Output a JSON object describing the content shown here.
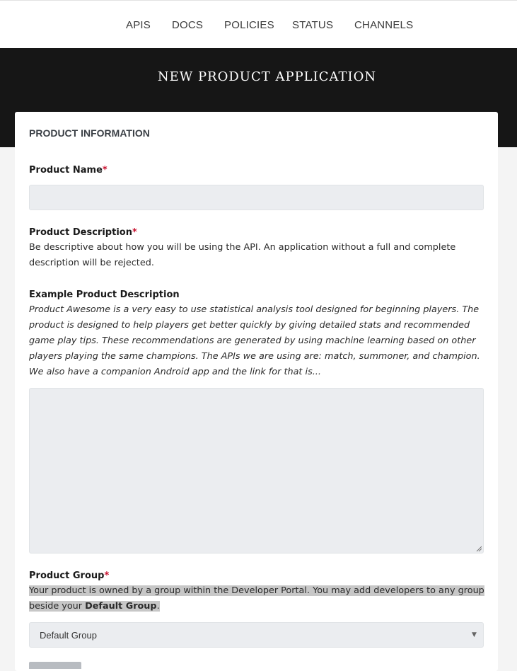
{
  "nav": {
    "items": [
      "APIS",
      "DOCS",
      "POLICIES",
      "STATUS",
      "CHANNELS"
    ]
  },
  "hero": {
    "title": "NEW PRODUCT APPLICATION"
  },
  "form": {
    "section_title": "PRODUCT INFORMATION",
    "required_marker": "*",
    "product_name": {
      "label": "Product Name",
      "value": ""
    },
    "product_description": {
      "label": "Product Description",
      "help": "Be descriptive about how you will be using the API. An application without a full and complete description will be rejected.",
      "value": ""
    },
    "example": {
      "label": "Example Product Description",
      "text": "Product Awesome is a very easy to use statistical analysis tool designed for beginning players. The product is designed to help players get better quickly by giving detailed stats and recommended game play tips. These recommendations are generated by using machine learning based on other players playing the same champions. The APIs we are using are: match, summoner, and champion. We also have a companion Android app and the link for that is..."
    },
    "product_group": {
      "label": "Product Group",
      "help_before": "Your product is owned by a group within the Developer Portal. You may add developers to any group beside your ",
      "help_bold": "Default Group",
      "help_after": ".",
      "selected": "Default Group"
    }
  },
  "colors": {
    "hero_bg": "#161616",
    "required": "#c8102e",
    "input_bg": "#ebedf0",
    "highlight": "#c7c7c7"
  }
}
